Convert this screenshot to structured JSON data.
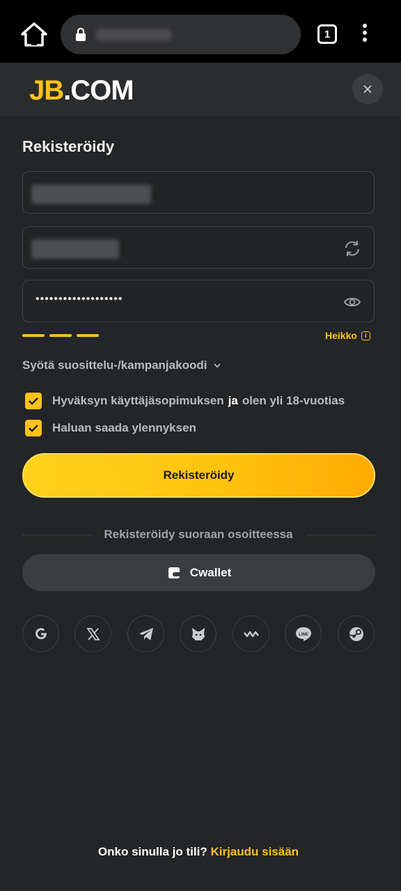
{
  "browser": {
    "tab_count": "1"
  },
  "header": {
    "logo_jb": "JB",
    "logo_dotcom": ".COM"
  },
  "form": {
    "title": "Rekisteröidy",
    "password_dots": "•••••••••••••••••••",
    "strength_label": "Heikko",
    "strength_level": "3 of 3 segments (weak)",
    "promo_label": "Syötä suosittelu-/kampanjakoodi",
    "agree_text": "Hyväksyn käyttäjäsopimuksen",
    "agree_conj": "ja",
    "agree_age": "olen yli 18-vuotias",
    "promotions_text": "Haluan saada ylennyksen",
    "submit_label": "Rekisteröidy"
  },
  "social": {
    "divider_text": "Rekisteröidy suoraan osoitteessa",
    "cwallet_label": "Cwallet",
    "icons": [
      "google-icon",
      "x-icon",
      "telegram-icon",
      "metamask-icon",
      "walletconnect-icon",
      "line-icon",
      "steam-icon"
    ],
    "line_label": "LINE"
  },
  "footer": {
    "question": "Onko sinulla jo tili?",
    "login_link": "Kirjaudu sisään"
  },
  "colors": {
    "accent": "#ffc21a",
    "background": "#232526",
    "header_bg": "#2a2c2e"
  }
}
